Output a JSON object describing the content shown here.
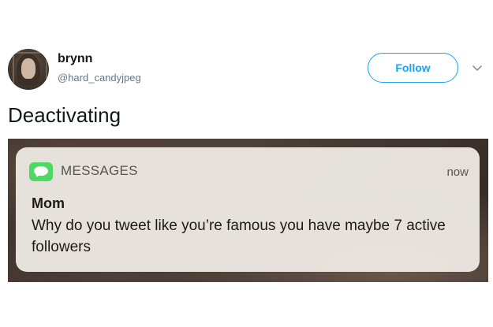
{
  "tweet": {
    "user": {
      "name": "brynn",
      "handle": "@hard_candyjpeg"
    },
    "follow_label": "Follow",
    "text": "Deactivating",
    "image": {
      "notification": {
        "app_name": "MESSAGES",
        "time": "now",
        "sender": "Mom",
        "body": "Why do you tweet like you’re famous you have maybe 7 active followers"
      }
    }
  },
  "colors": {
    "accent": "#1da1f2",
    "imessage_green": "#4cd964",
    "text_primary": "#14171a",
    "text_secondary": "#657786"
  },
  "icons": {
    "avatar": "user-avatar",
    "more": "chevron-down-icon",
    "app": "messages-icon"
  }
}
